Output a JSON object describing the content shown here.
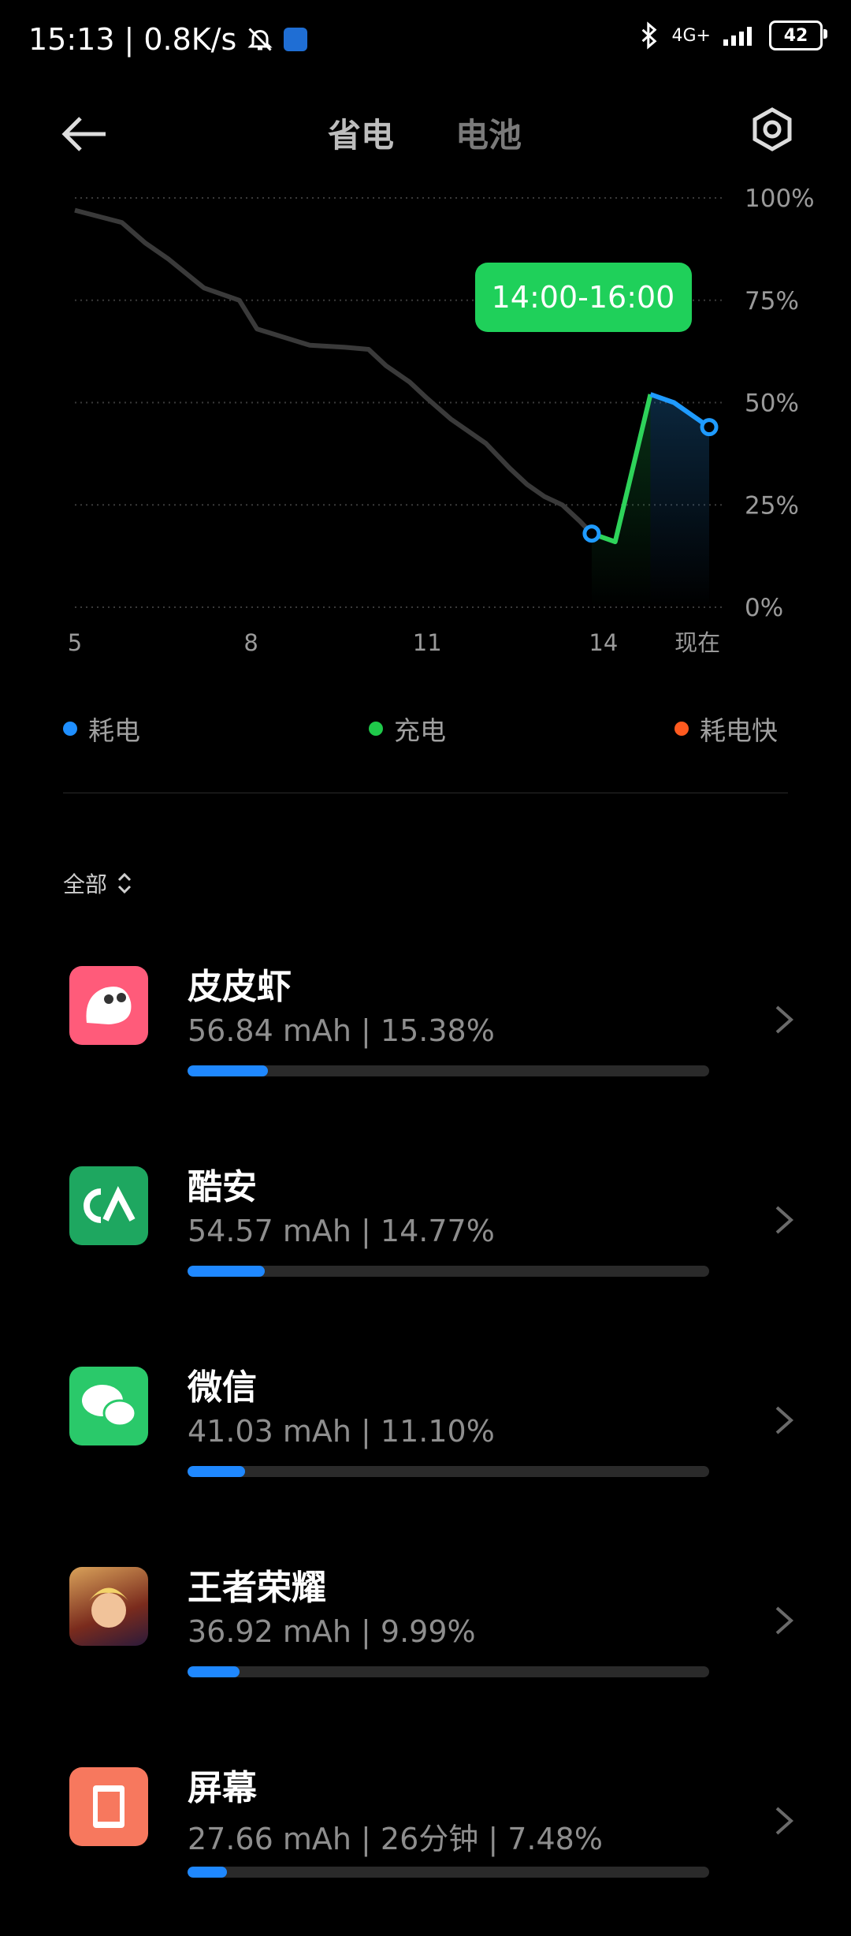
{
  "status_bar": {
    "time": "15:13",
    "net_speed": "0.8K/s",
    "network": "4G+",
    "battery": "42"
  },
  "header": {
    "tabs": [
      "省电",
      "电池"
    ],
    "active_tab": "省电"
  },
  "chart_data": {
    "type": "line",
    "x_ticks": [
      "5",
      "8",
      "11",
      "14",
      "现在"
    ],
    "y_ticks": [
      "100%",
      "75%",
      "50%",
      "25%",
      "0%"
    ],
    "ylim": [
      0,
      100
    ],
    "tooltip": "14:00-16:00",
    "series": [
      {
        "name": "耗电",
        "x": [
          5.0,
          5.8,
          6.2,
          6.6,
          7.2,
          7.8,
          8.1,
          9.0,
          9.6,
          10.0,
          10.3,
          10.7,
          11.0,
          11.4,
          12.0,
          12.4,
          12.7,
          13.0,
          13.3,
          13.6,
          13.8
        ],
        "values": [
          97,
          94,
          89,
          85,
          78,
          75,
          68,
          64,
          63.5,
          63,
          59,
          55,
          51,
          46,
          40,
          34,
          30,
          27,
          25,
          21,
          18
        ]
      },
      {
        "name": "充电",
        "x": [
          13.8,
          14.2,
          14.8
        ],
        "values": [
          18,
          16,
          52
        ]
      },
      {
        "name": "耗电",
        "x": [
          14.8,
          15.2,
          15.6,
          15.8
        ],
        "values": [
          52,
          50,
          46,
          44
        ]
      }
    ],
    "legend": [
      {
        "label": "耗电",
        "color": "#1f8fff"
      },
      {
        "label": "充电",
        "color": "#1fc94a"
      },
      {
        "label": "耗电快",
        "color": "#ff5a1f"
      }
    ]
  },
  "filter": {
    "label": "全部"
  },
  "apps": [
    {
      "name": "皮皮虾",
      "stats": "56.84 mAh | 15.38%",
      "percent": 15.38,
      "icon": "pipixia-icon",
      "color": "#ff5b7a"
    },
    {
      "name": "酷安",
      "stats": "54.57 mAh | 14.77%",
      "percent": 14.77,
      "icon": "coolapk-icon",
      "color": "#1ea760"
    },
    {
      "name": "微信",
      "stats": "41.03 mAh | 11.10%",
      "percent": 11.1,
      "icon": "wechat-icon",
      "color": "#2ac96a"
    },
    {
      "name": "王者荣耀",
      "stats": "36.92 mAh | 9.99%",
      "percent": 9.99,
      "icon": "honor-of-kings-icon",
      "color": "#b5482a"
    },
    {
      "name": "屏幕",
      "stats": "27.66 mAh | 26分钟 | 7.48%",
      "percent": 7.48,
      "icon": "screen-icon",
      "color": "#f7785e"
    }
  ]
}
